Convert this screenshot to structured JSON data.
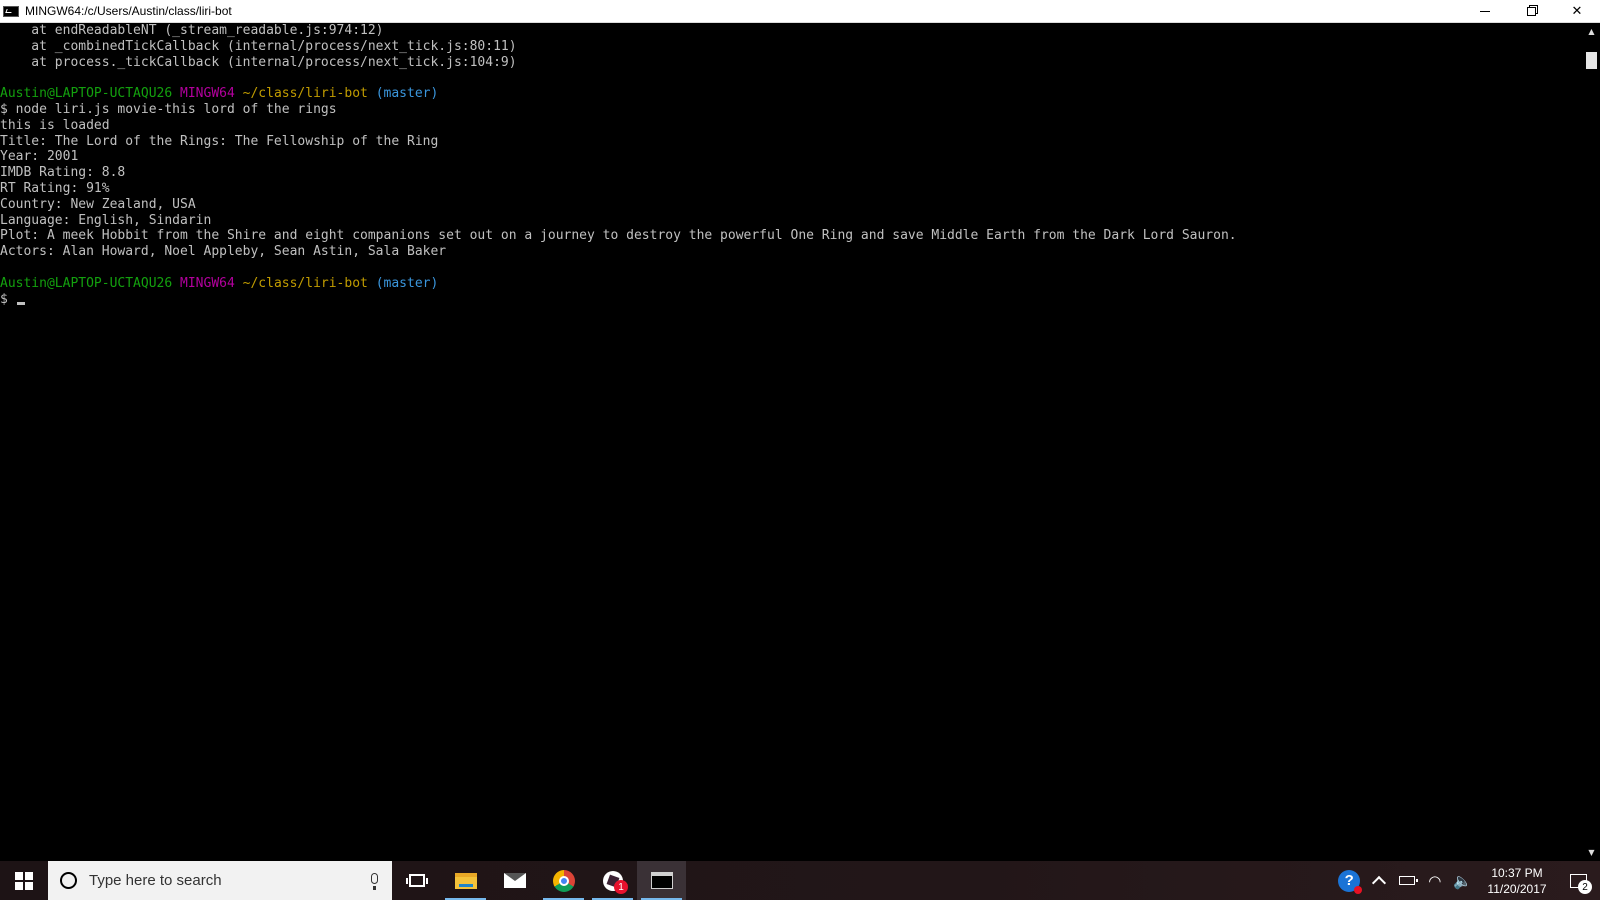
{
  "window": {
    "title": "MINGW64:/c/Users/Austin/class/liri-bot",
    "controls": {
      "minimize": "",
      "restore": "",
      "close": "✕"
    }
  },
  "terminal": {
    "lines": [
      {
        "segments": [
          {
            "text": "    at endReadableNT (_stream_readable.js:974:12)",
            "role": "default"
          }
        ]
      },
      {
        "segments": [
          {
            "text": "    at _combinedTickCallback (internal/process/next_tick.js:80:11)",
            "role": "default"
          }
        ]
      },
      {
        "segments": [
          {
            "text": "    at process._tickCallback (internal/process/next_tick.js:104:9)",
            "role": "default"
          }
        ]
      },
      {
        "segments": [
          {
            "text": "",
            "role": "default"
          }
        ]
      },
      {
        "segments": [
          {
            "text": "Austin@LAPTOP-UCTAQU26",
            "role": "user"
          },
          {
            "text": " ",
            "role": "default"
          },
          {
            "text": "MINGW64",
            "role": "sys"
          },
          {
            "text": " ",
            "role": "default"
          },
          {
            "text": "~/class/liri-bot",
            "role": "path"
          },
          {
            "text": " ",
            "role": "default"
          },
          {
            "text": "(master)",
            "role": "branch"
          }
        ]
      },
      {
        "segments": [
          {
            "text": "$ node liri.js movie-this lord of the rings",
            "role": "default"
          }
        ]
      },
      {
        "segments": [
          {
            "text": "this is loaded",
            "role": "default"
          }
        ]
      },
      {
        "segments": [
          {
            "text": "Title: The Lord of the Rings: The Fellowship of the Ring",
            "role": "default"
          }
        ]
      },
      {
        "segments": [
          {
            "text": "Year: 2001",
            "role": "default"
          }
        ]
      },
      {
        "segments": [
          {
            "text": "IMDB Rating: 8.8",
            "role": "default"
          }
        ]
      },
      {
        "segments": [
          {
            "text": "RT Rating: 91%",
            "role": "default"
          }
        ]
      },
      {
        "segments": [
          {
            "text": "Country: New Zealand, USA",
            "role": "default"
          }
        ]
      },
      {
        "segments": [
          {
            "text": "Language: English, Sindarin",
            "role": "default"
          }
        ]
      },
      {
        "segments": [
          {
            "text": "Plot: A meek Hobbit from the Shire and eight companions set out on a journey to destroy the powerful One Ring and save Middle Earth from the Dark Lord Sauron.",
            "role": "default"
          }
        ]
      },
      {
        "segments": [
          {
            "text": "Actors: Alan Howard, Noel Appleby, Sean Astin, Sala Baker",
            "role": "default"
          }
        ]
      },
      {
        "segments": [
          {
            "text": "",
            "role": "default"
          }
        ]
      },
      {
        "segments": [
          {
            "text": "Austin@LAPTOP-UCTAQU26",
            "role": "user"
          },
          {
            "text": " ",
            "role": "default"
          },
          {
            "text": "MINGW64",
            "role": "sys"
          },
          {
            "text": " ",
            "role": "default"
          },
          {
            "text": "~/class/liri-bot",
            "role": "path"
          },
          {
            "text": " ",
            "role": "default"
          },
          {
            "text": "(master)",
            "role": "branch"
          }
        ]
      },
      {
        "segments": [
          {
            "text": "$ ",
            "role": "default"
          }
        ],
        "cursor": true
      }
    ],
    "colors": {
      "default": "#c0c0c0",
      "user": "#13a10e",
      "sys": "#b4009e",
      "path": "#c19c00",
      "branch": "#3a96dd",
      "background": "#000000"
    }
  },
  "scrollbar": {
    "up_arrow": "▲",
    "down_arrow": "▼"
  },
  "taskbar": {
    "search_placeholder": "Type here to search",
    "apps": [
      {
        "name": "task-view",
        "icon": "task-view-icon"
      },
      {
        "name": "file-explorer",
        "icon": "folder-icon"
      },
      {
        "name": "mail",
        "icon": "mail-icon"
      },
      {
        "name": "chrome",
        "icon": "chrome-icon"
      },
      {
        "name": "slack",
        "icon": "slack-icon",
        "badge": "1"
      },
      {
        "name": "git-bash",
        "icon": "terminal-icon"
      }
    ],
    "tray": {
      "help_glyph": "?",
      "wifi_glyph": "◠",
      "volume_glyph": "🔈",
      "time": "10:37 PM",
      "date": "11/20/2017",
      "notification_count": "2"
    }
  }
}
